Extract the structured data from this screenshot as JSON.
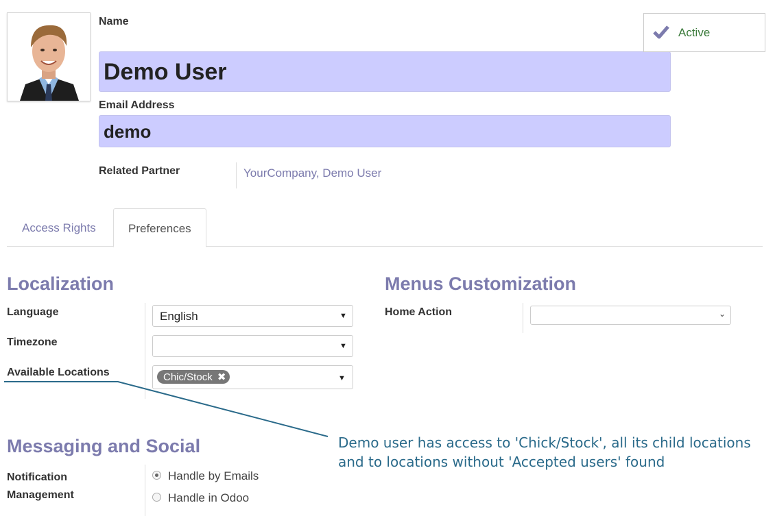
{
  "header": {
    "name_label": "Name",
    "name_value": "Demo User",
    "email_label": "Email Address",
    "email_value": "demo",
    "partner_label": "Related Partner",
    "partner_value": "YourCompany, Demo User"
  },
  "status": {
    "active_label": "Active",
    "icon": "check-icon"
  },
  "tabs": [
    {
      "label": "Access Rights",
      "active": false
    },
    {
      "label": "Preferences",
      "active": true
    }
  ],
  "localization": {
    "title": "Localization",
    "language_label": "Language",
    "language_value": "English",
    "timezone_label": "Timezone",
    "timezone_value": "",
    "locations_label": "Available Locations",
    "locations_tag": "Chic/Stock"
  },
  "menus": {
    "title": "Menus Customization",
    "home_action_label": "Home Action",
    "home_action_value": ""
  },
  "messaging": {
    "title": "Messaging and Social",
    "notification_label_line1": "Notification",
    "notification_label_line2": "Management",
    "options": [
      {
        "label": "Handle by Emails",
        "checked": true
      },
      {
        "label": "Handle in Odoo",
        "checked": false
      }
    ]
  },
  "annotation": {
    "line1": "Demo user has access to 'Chick/Stock', all its child locations",
    "line2": "and to locations without 'Accepted users' found"
  },
  "colors": {
    "accent": "#7c7bad",
    "input_highlight": "#ccccff",
    "annotation": "#2a6a8a",
    "active_text": "#3a7a3a"
  }
}
